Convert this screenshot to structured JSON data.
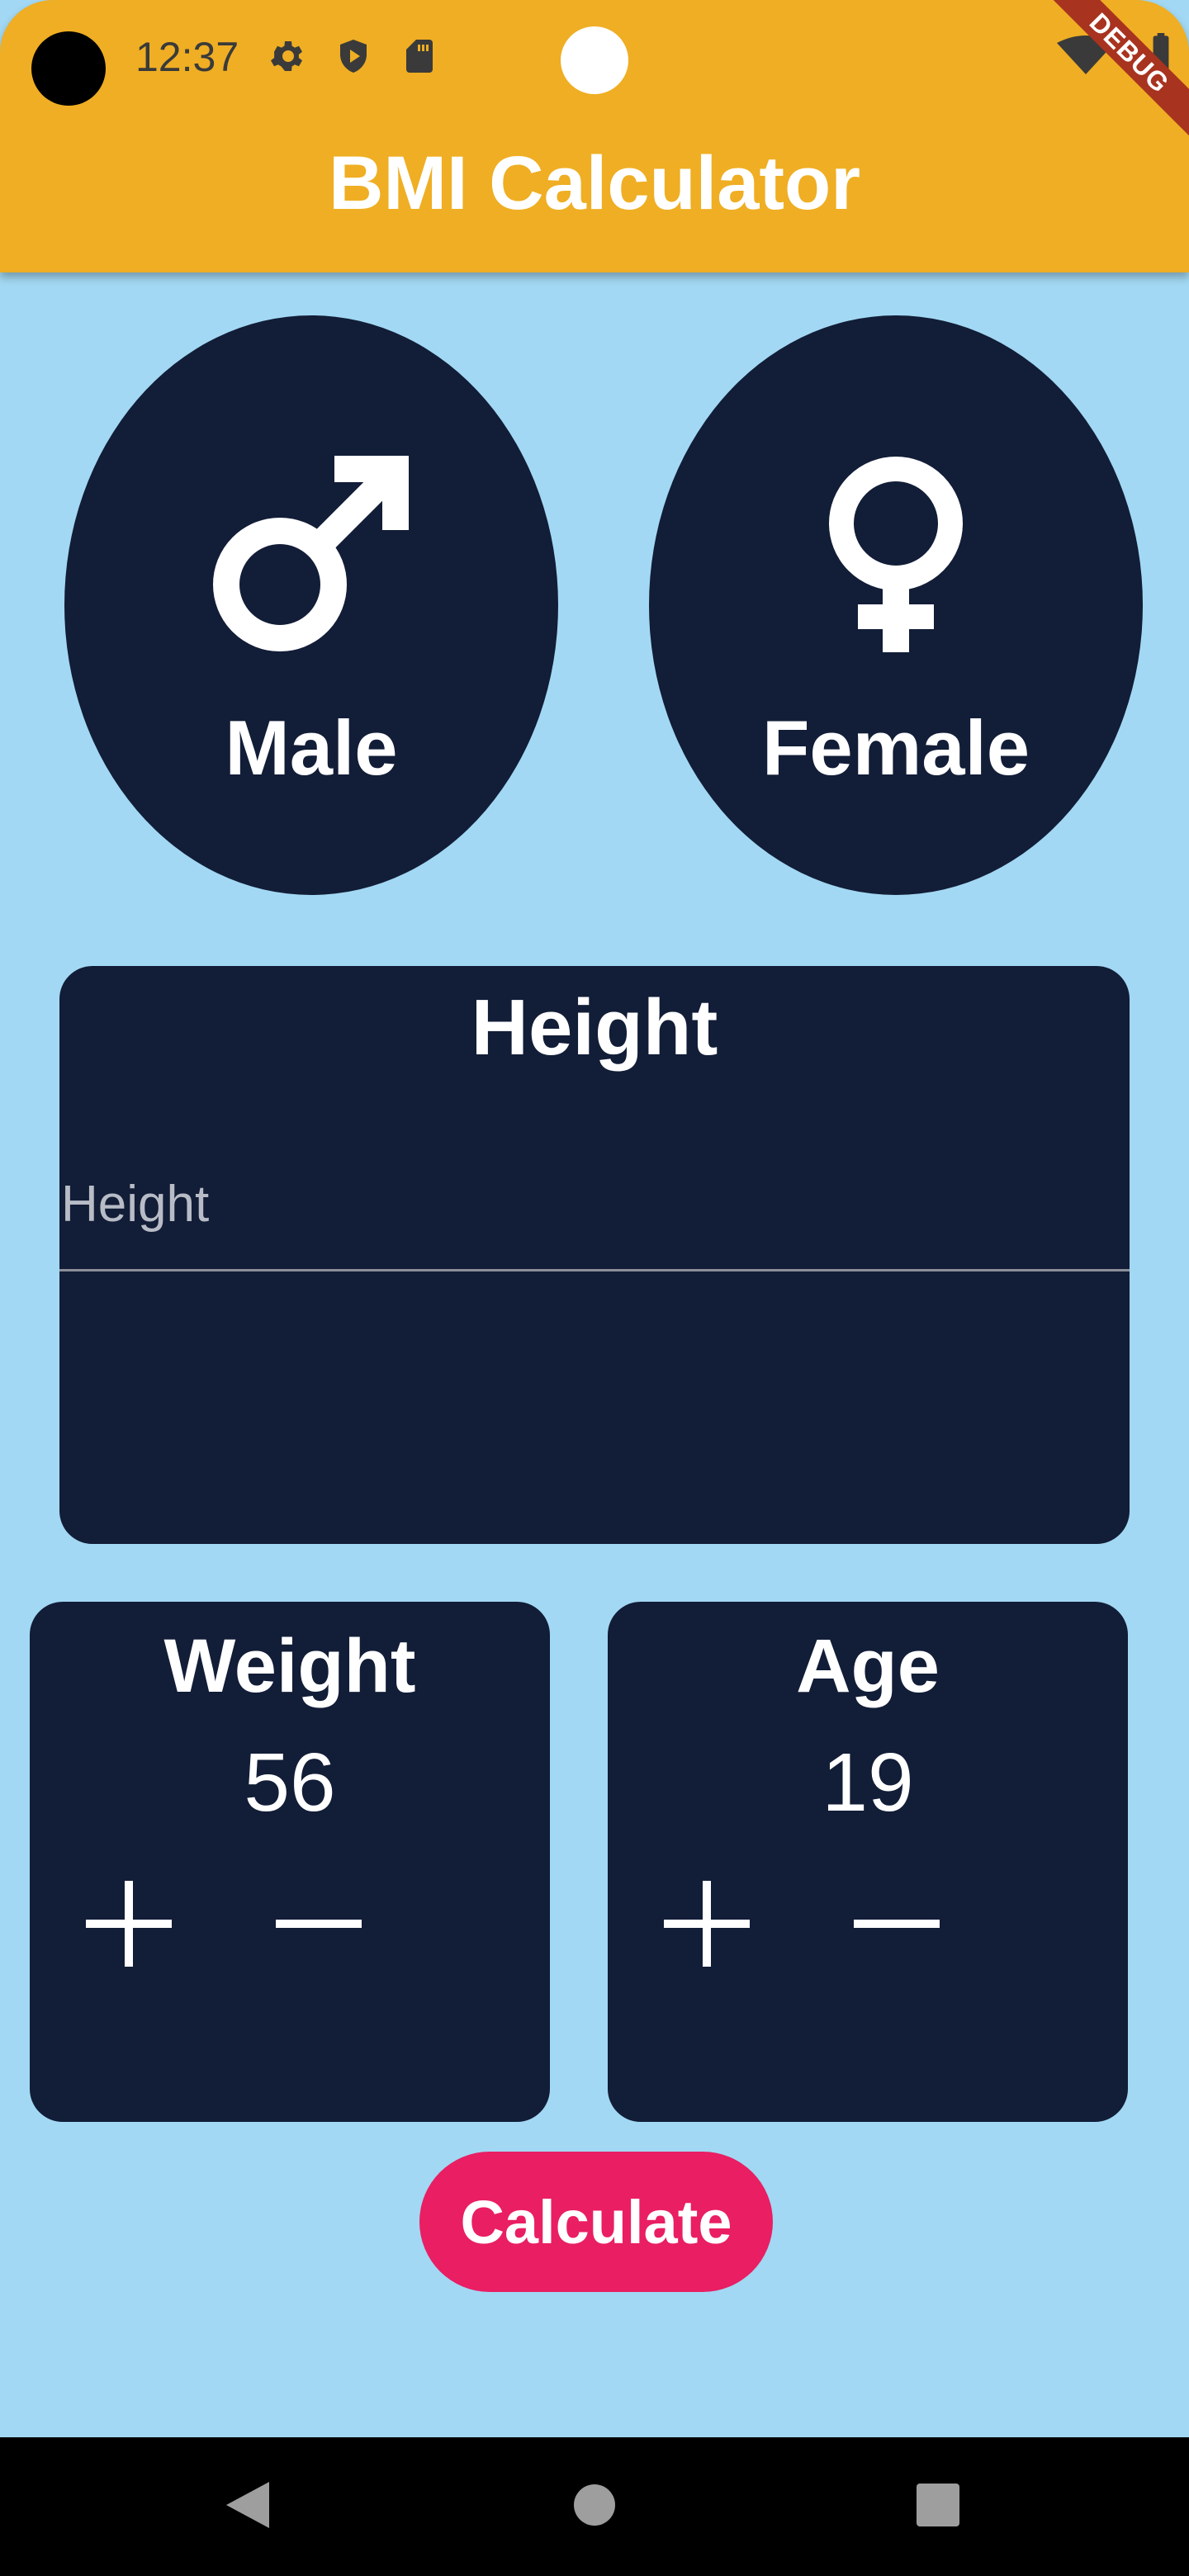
{
  "status_bar": {
    "time": "12:37",
    "icons": [
      "settings-icon",
      "play-protect-icon",
      "sd-card-icon",
      "wifi-icon",
      "battery-icon"
    ]
  },
  "debug_banner": "DEBUG",
  "app_bar": {
    "title": "BMI Calculator"
  },
  "gender": {
    "male": {
      "label": "Male",
      "icon": "male-symbol-icon"
    },
    "female": {
      "label": "Female",
      "icon": "female-symbol-icon"
    }
  },
  "height": {
    "title": "Height",
    "placeholder": "Height",
    "value": ""
  },
  "weight": {
    "title": "Weight",
    "value": "56"
  },
  "age": {
    "title": "Age",
    "value": "19"
  },
  "calculate_label": "Calculate",
  "colors": {
    "app_bar": "#efae23",
    "background": "#a2d8f3",
    "card": "#121d37",
    "accent_button": "#e91e63",
    "text": "#ffffff"
  },
  "nav_bar": {
    "icons": [
      "back-icon",
      "home-icon",
      "recents-icon"
    ]
  }
}
